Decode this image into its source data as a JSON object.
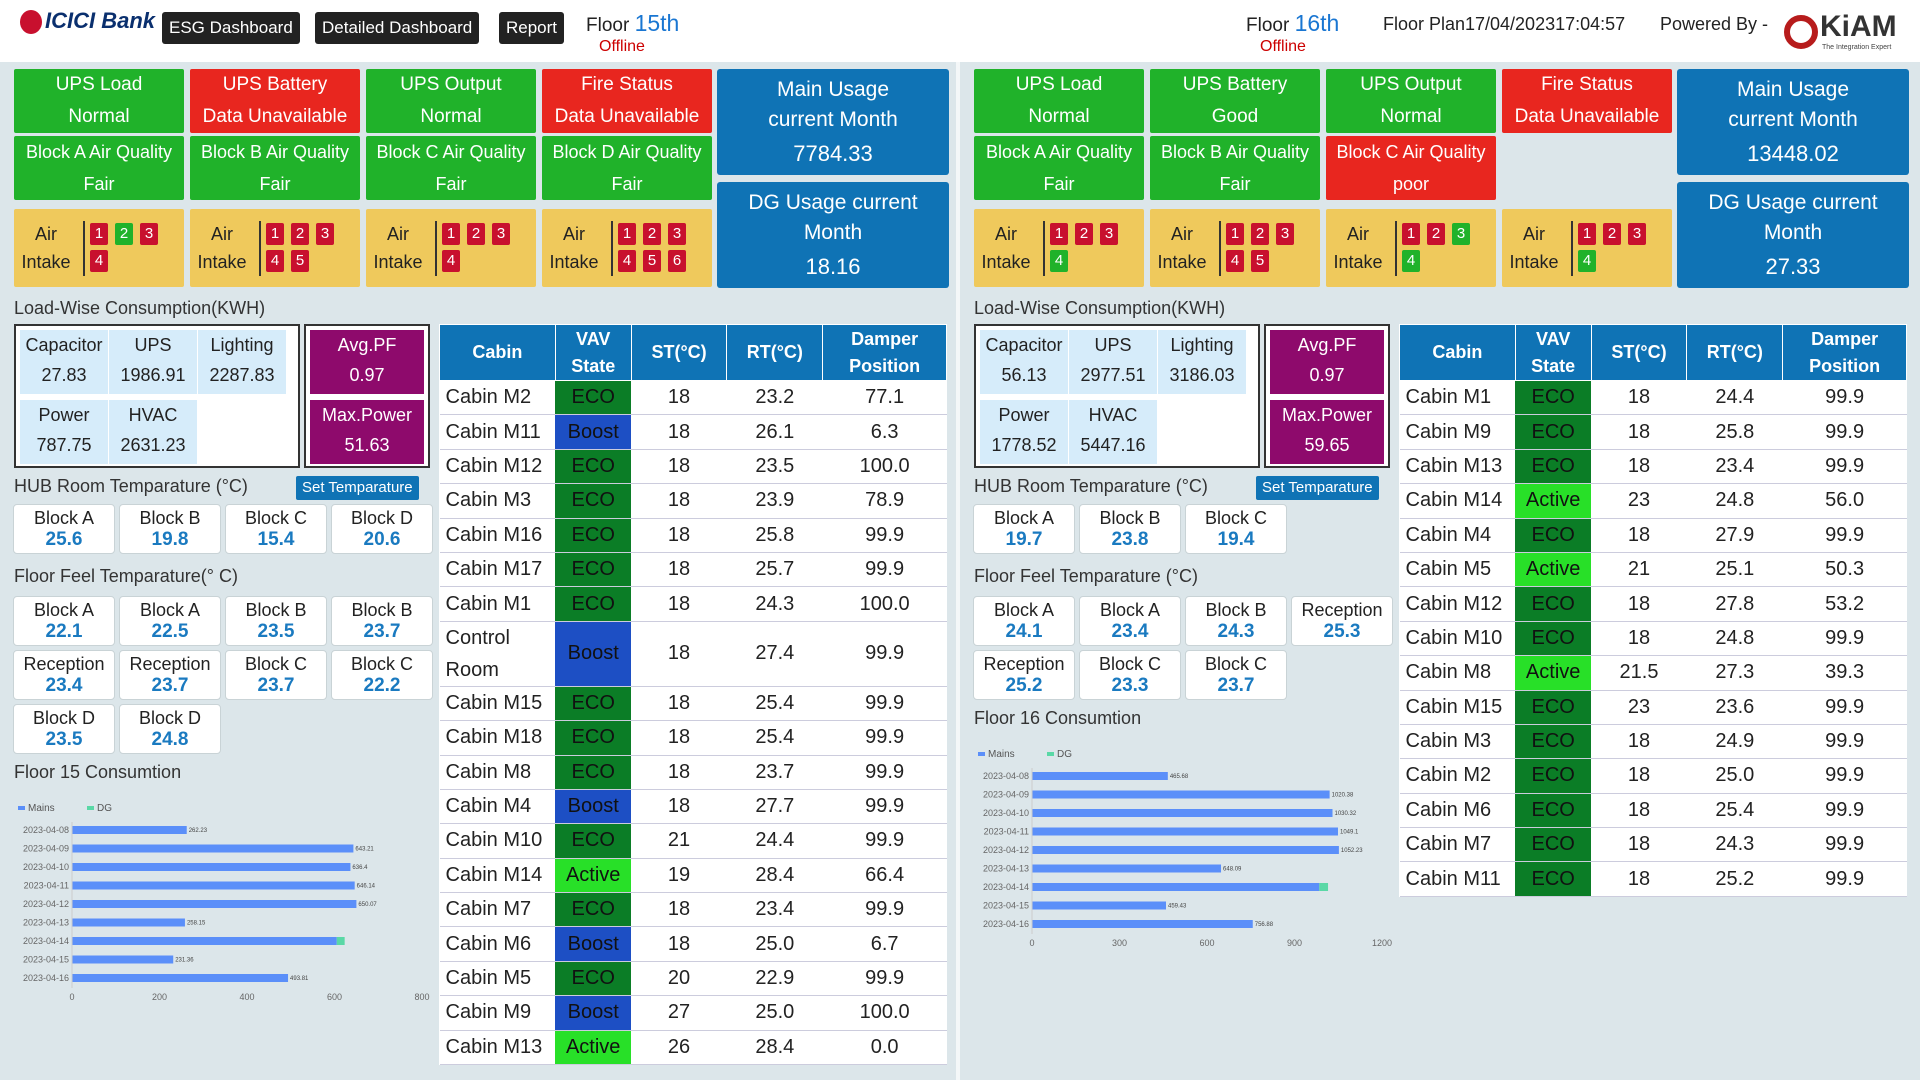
{
  "header": {
    "brand": "ICICI Bank",
    "nav": [
      "ESG Dashboard",
      "Detailed Dashboard",
      "Report"
    ],
    "floor_label": "Floor",
    "floor_plan": "Floor Plan",
    "datetime": "17/04/202317:04:57",
    "powered_by": "Powered By -",
    "kiam_name": "KiAM",
    "kiam_tagline": "The Integration Expert"
  },
  "colors": {
    "ok": "#20b22a",
    "alert": "#e8261f",
    "usage": "#0f73b5",
    "pf": "#8e0a6c",
    "eco": "#0b7d26",
    "boost": "#1d4fc4",
    "active": "#28e028"
  },
  "icons": [
    "icici-logo-icon",
    "kiam-logo-icon"
  ],
  "panels": [
    {
      "floor": "15th",
      "status": "Offline",
      "status_tiles": [
        {
          "title": "UPS Load",
          "value": "Normal",
          "state": "ok"
        },
        {
          "title": "UPS Battery",
          "value": "Data Unavailable",
          "state": "alert"
        },
        {
          "title": "UPS Output",
          "value": "Normal",
          "state": "ok"
        },
        {
          "title": "Fire Status",
          "value": "Data Unavailable",
          "state": "alert"
        }
      ],
      "air_quality": [
        {
          "title": "Block A Air Quality",
          "value": "Fair",
          "state": "ok"
        },
        {
          "title": "Block B Air Quality",
          "value": "Fair",
          "state": "ok"
        },
        {
          "title": "Block C Air Quality",
          "value": "Fair",
          "state": "ok"
        },
        {
          "title": "Block D Air Quality",
          "value": "Fair",
          "state": "ok"
        }
      ],
      "air_intakes": [
        {
          "label": "Air Intake",
          "units": [
            {
              "n": "1",
              "c": "red"
            },
            {
              "n": "2",
              "c": "grn"
            },
            {
              "n": "3",
              "c": "red"
            },
            {
              "n": "4",
              "c": "red"
            }
          ]
        },
        {
          "label": "Air Intake",
          "units": [
            {
              "n": "1",
              "c": "red"
            },
            {
              "n": "2",
              "c": "red"
            },
            {
              "n": "3",
              "c": "red"
            },
            {
              "n": "4",
              "c": "red"
            },
            {
              "n": "5",
              "c": "red"
            }
          ]
        },
        {
          "label": "Air Intake",
          "units": [
            {
              "n": "1",
              "c": "red"
            },
            {
              "n": "2",
              "c": "red"
            },
            {
              "n": "3",
              "c": "red"
            },
            {
              "n": "4",
              "c": "red"
            }
          ]
        },
        {
          "label": "Air Intake",
          "units": [
            {
              "n": "1",
              "c": "red"
            },
            {
              "n": "2",
              "c": "red"
            },
            {
              "n": "3",
              "c": "red"
            },
            {
              "n": "4",
              "c": "red"
            },
            {
              "n": "5",
              "c": "red"
            },
            {
              "n": "6",
              "c": "red"
            }
          ]
        }
      ],
      "main_usage": {
        "title": "Main Usage current Month",
        "value": "7784.33"
      },
      "dg_usage": {
        "title": "DG Usage current Month",
        "value": "18.16"
      },
      "load_title": "Load-Wise Consumption(KWH)",
      "load": {
        "capacitor": "27.83",
        "ups": "1986.91",
        "lighting": "2287.83",
        "power": "787.75",
        "hvac": "2631.23"
      },
      "load_labels": {
        "capacitor": "Capacitor",
        "ups": "UPS",
        "lighting": "Lighting",
        "power": "Power",
        "hvac": "HVAC"
      },
      "avg_pf": {
        "title": "Avg.PF",
        "value": "0.97"
      },
      "max_power": {
        "title": "Max.Power",
        "value": "51.63"
      },
      "hub_title": "HUB Room Temparature (°C)",
      "set_temp": "Set Temparature",
      "hub_temps": [
        {
          "name": "Block A",
          "value": "25.6"
        },
        {
          "name": "Block B",
          "value": "19.8"
        },
        {
          "name": "Block C",
          "value": "15.4"
        },
        {
          "name": "Block D",
          "value": "20.6"
        }
      ],
      "feel_title": "Floor Feel Temparature(° C)",
      "feel_temps": [
        {
          "name": "Block A",
          "value": "22.1"
        },
        {
          "name": "Block A",
          "value": "22.5"
        },
        {
          "name": "Block B",
          "value": "23.5"
        },
        {
          "name": "Block B",
          "value": "23.7"
        },
        {
          "name": "Reception",
          "value": "23.4"
        },
        {
          "name": "Reception",
          "value": "23.7"
        },
        {
          "name": "Block C",
          "value": "23.7"
        },
        {
          "name": "Block C",
          "value": "22.2"
        },
        {
          "name": "Block D",
          "value": "23.5"
        },
        {
          "name": "Block D",
          "value": "24.8"
        }
      ],
      "cons_title": "Floor 15 Consumtion",
      "cabin_headers": [
        "Cabin",
        "VAV State",
        "ST(°C)",
        "RT(°C)",
        "Damper Position"
      ],
      "cabins": [
        {
          "name": "Cabin M2",
          "vav": "ECO",
          "st": "18",
          "rt": "23.2",
          "damper": "77.1"
        },
        {
          "name": "Cabin M11",
          "vav": "Boost",
          "st": "18",
          "rt": "26.1",
          "damper": "6.3"
        },
        {
          "name": "Cabin M12",
          "vav": "ECO",
          "st": "18",
          "rt": "23.5",
          "damper": "100.0"
        },
        {
          "name": "Cabin M3",
          "vav": "ECO",
          "st": "18",
          "rt": "23.9",
          "damper": "78.9"
        },
        {
          "name": "Cabin M16",
          "vav": "ECO",
          "st": "18",
          "rt": "25.8",
          "damper": "99.9"
        },
        {
          "name": "Cabin M17",
          "vav": "ECO",
          "st": "18",
          "rt": "25.7",
          "damper": "99.9"
        },
        {
          "name": "Cabin M1",
          "vav": "ECO",
          "st": "18",
          "rt": "24.3",
          "damper": "100.0"
        },
        {
          "name": "Control Room",
          "vav": "Boost",
          "st": "18",
          "rt": "27.4",
          "damper": "99.9"
        },
        {
          "name": "Cabin M15",
          "vav": "ECO",
          "st": "18",
          "rt": "25.4",
          "damper": "99.9"
        },
        {
          "name": "Cabin M18",
          "vav": "ECO",
          "st": "18",
          "rt": "25.4",
          "damper": "99.9"
        },
        {
          "name": "Cabin M8",
          "vav": "ECO",
          "st": "18",
          "rt": "23.7",
          "damper": "99.9"
        },
        {
          "name": "Cabin M4",
          "vav": "Boost",
          "st": "18",
          "rt": "27.7",
          "damper": "99.9"
        },
        {
          "name": "Cabin M10",
          "vav": "ECO",
          "st": "21",
          "rt": "24.4",
          "damper": "99.9"
        },
        {
          "name": "Cabin M14",
          "vav": "Active",
          "st": "19",
          "rt": "28.4",
          "damper": "66.4"
        },
        {
          "name": "Cabin M7",
          "vav": "ECO",
          "st": "18",
          "rt": "23.4",
          "damper": "99.9"
        },
        {
          "name": "Cabin M6",
          "vav": "Boost",
          "st": "18",
          "rt": "25.0",
          "damper": "6.7"
        },
        {
          "name": "Cabin M5",
          "vav": "ECO",
          "st": "20",
          "rt": "22.9",
          "damper": "99.9"
        },
        {
          "name": "Cabin M9",
          "vav": "Boost",
          "st": "27",
          "rt": "25.0",
          "damper": "100.0"
        },
        {
          "name": "Cabin M13",
          "vav": "Active",
          "st": "26",
          "rt": "28.4",
          "damper": "0.0"
        }
      ]
    },
    {
      "floor": "16th",
      "status": "Offline",
      "status_tiles": [
        {
          "title": "UPS Load",
          "value": "Normal",
          "state": "ok"
        },
        {
          "title": "UPS Battery",
          "value": "Good",
          "state": "ok"
        },
        {
          "title": "UPS Output",
          "value": "Normal",
          "state": "ok"
        },
        {
          "title": "Fire Status",
          "value": "Data Unavailable",
          "state": "alert"
        }
      ],
      "air_quality": [
        {
          "title": "Block A Air Quality",
          "value": "Fair",
          "state": "ok"
        },
        {
          "title": "Block B Air Quality",
          "value": "Fair",
          "state": "ok"
        },
        {
          "title": "Block C Air Quality",
          "value": "poor",
          "state": "alert"
        }
      ],
      "air_intakes": [
        {
          "label": "Air Intake",
          "units": [
            {
              "n": "1",
              "c": "red"
            },
            {
              "n": "2",
              "c": "red"
            },
            {
              "n": "3",
              "c": "red"
            },
            {
              "n": "4",
              "c": "grn"
            }
          ]
        },
        {
          "label": "Air Intake",
          "units": [
            {
              "n": "1",
              "c": "red"
            },
            {
              "n": "2",
              "c": "red"
            },
            {
              "n": "3",
              "c": "red"
            },
            {
              "n": "4",
              "c": "red"
            },
            {
              "n": "5",
              "c": "red"
            }
          ]
        },
        {
          "label": "Air Intake",
          "units": [
            {
              "n": "1",
              "c": "red"
            },
            {
              "n": "2",
              "c": "red"
            },
            {
              "n": "3",
              "c": "grn"
            },
            {
              "n": "4",
              "c": "grn"
            }
          ]
        },
        {
          "label": "Air Intake",
          "units": [
            {
              "n": "1",
              "c": "red"
            },
            {
              "n": "2",
              "c": "red"
            },
            {
              "n": "3",
              "c": "red"
            },
            {
              "n": "4",
              "c": "grn"
            }
          ]
        }
      ],
      "main_usage": {
        "title": "Main Usage current Month",
        "value": "13448.02"
      },
      "dg_usage": {
        "title": "DG Usage current Month",
        "value": "27.33"
      },
      "load_title": "Load-Wise Consumption(KWH)",
      "load": {
        "capacitor": "56.13",
        "ups": "2977.51",
        "lighting": "3186.03",
        "power": "1778.52",
        "hvac": "5447.16"
      },
      "load_labels": {
        "capacitor": "Capacitor",
        "ups": "UPS",
        "lighting": "Lighting",
        "power": "Power",
        "hvac": "HVAC"
      },
      "avg_pf": {
        "title": "Avg.PF",
        "value": "0.97"
      },
      "max_power": {
        "title": "Max.Power",
        "value": "59.65"
      },
      "hub_title": "HUB Room Temparature (°C)",
      "set_temp": "Set Temparature",
      "hub_temps": [
        {
          "name": "Block A",
          "value": "19.7"
        },
        {
          "name": "Block B",
          "value": "23.8"
        },
        {
          "name": "Block C",
          "value": "19.4"
        }
      ],
      "feel_title": "Floor Feel Temparature (°C)",
      "feel_temps": [
        {
          "name": "Block A",
          "value": "24.1"
        },
        {
          "name": "Block A",
          "value": "23.4"
        },
        {
          "name": "Block B",
          "value": "24.3"
        },
        {
          "name": "Reception",
          "value": "25.3"
        },
        {
          "name": "Reception",
          "value": "25.2"
        },
        {
          "name": "Block C",
          "value": "23.3"
        },
        {
          "name": "Block C",
          "value": "23.7"
        }
      ],
      "cons_title": "Floor 16 Consumtion",
      "cabin_headers": [
        "Cabin",
        "VAV State",
        "ST(°C)",
        "RT(°C)",
        "Damper Position"
      ],
      "cabins": [
        {
          "name": "Cabin M1",
          "vav": "ECO",
          "st": "18",
          "rt": "24.4",
          "damper": "99.9"
        },
        {
          "name": "Cabin M9",
          "vav": "ECO",
          "st": "18",
          "rt": "25.8",
          "damper": "99.9"
        },
        {
          "name": "Cabin M13",
          "vav": "ECO",
          "st": "18",
          "rt": "23.4",
          "damper": "99.9"
        },
        {
          "name": "Cabin M14",
          "vav": "Active",
          "st": "23",
          "rt": "24.8",
          "damper": "56.0"
        },
        {
          "name": "Cabin M4",
          "vav": "ECO",
          "st": "18",
          "rt": "27.9",
          "damper": "99.9"
        },
        {
          "name": "Cabin M5",
          "vav": "Active",
          "st": "21",
          "rt": "25.1",
          "damper": "50.3"
        },
        {
          "name": "Cabin M12",
          "vav": "ECO",
          "st": "18",
          "rt": "27.8",
          "damper": "53.2"
        },
        {
          "name": "Cabin M10",
          "vav": "ECO",
          "st": "18",
          "rt": "24.8",
          "damper": "99.9"
        },
        {
          "name": "Cabin M8",
          "vav": "Active",
          "st": "21.5",
          "rt": "27.3",
          "damper": "39.3"
        },
        {
          "name": "Cabin M15",
          "vav": "ECO",
          "st": "23",
          "rt": "23.6",
          "damper": "99.9"
        },
        {
          "name": "Cabin M3",
          "vav": "ECO",
          "st": "18",
          "rt": "24.9",
          "damper": "99.9"
        },
        {
          "name": "Cabin M2",
          "vav": "ECO",
          "st": "18",
          "rt": "25.0",
          "damper": "99.9"
        },
        {
          "name": "Cabin M6",
          "vav": "ECO",
          "st": "18",
          "rt": "25.4",
          "damper": "99.9"
        },
        {
          "name": "Cabin M7",
          "vav": "ECO",
          "st": "18",
          "rt": "24.3",
          "damper": "99.9"
        },
        {
          "name": "Cabin M11",
          "vav": "ECO",
          "st": "18",
          "rt": "25.2",
          "damper": "99.9"
        }
      ]
    }
  ],
  "chart_data": [
    {
      "type": "bar",
      "orientation": "horizontal",
      "stacked": true,
      "legend": [
        "Mains",
        "DG"
      ],
      "legend_position": "top-left",
      "categories": [
        "2023-04-08",
        "2023-04-09",
        "2023-04-10",
        "2023-04-11",
        "2023-04-12",
        "2023-04-13",
        "2023-04-14",
        "2023-04-15",
        "2023-04-16"
      ],
      "series": [
        {
          "name": "Mains",
          "values": [
            262.23,
            643.21,
            636.4,
            646.14,
            650.07,
            258.15,
            605.21,
            231.36,
            493.81
          ]
        },
        {
          "name": "DG",
          "values": [
            0,
            0,
            0,
            0,
            0,
            0,
            18,
            0,
            0
          ]
        }
      ],
      "labels": [
        "262.23",
        "643.21",
        "636.4",
        "646.14",
        "650.07",
        "258.15",
        "",
        "231.36",
        "493.81"
      ],
      "xticks": [
        "0",
        "200",
        "400",
        "600",
        "800"
      ],
      "xlim": [
        0,
        800
      ]
    },
    {
      "type": "bar",
      "orientation": "horizontal",
      "stacked": true,
      "legend": [
        "Mains",
        "DG"
      ],
      "legend_position": "top-left",
      "categories": [
        "2023-04-08",
        "2023-04-09",
        "2023-04-10",
        "2023-04-11",
        "2023-04-12",
        "2023-04-13",
        "2023-04-14",
        "2023-04-15",
        "2023-04-16"
      ],
      "series": [
        {
          "name": "Mains",
          "values": [
            465.68,
            1020.38,
            1030.32,
            1049.1,
            1052.23,
            648.09,
            985,
            459.43,
            756.88
          ]
        },
        {
          "name": "DG",
          "values": [
            0,
            0,
            0,
            0,
            0,
            0,
            30,
            0,
            0
          ]
        }
      ],
      "labels": [
        "465.68",
        "1020.38",
        "1030.32",
        "1049.1",
        "1052.23",
        "648.09",
        "",
        "459.43",
        "756.88"
      ],
      "xticks": [
        "0",
        "300",
        "600",
        "900",
        "1200"
      ],
      "xlim": [
        0,
        1200
      ]
    }
  ]
}
